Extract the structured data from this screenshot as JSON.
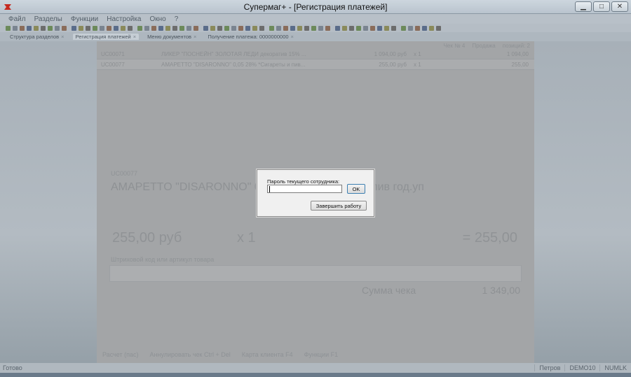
{
  "window": {
    "title": "Супермаг+  - [Регистрация платежей]",
    "minimize": "▁",
    "maximize": "□",
    "close": "✕"
  },
  "menu": [
    "Файл",
    "Разделы",
    "Функции",
    "Настройка",
    "Окно",
    "?"
  ],
  "tabs": [
    {
      "label": "Структура разделов",
      "active": false
    },
    {
      "label": "Регистрация платежей",
      "active": true
    },
    {
      "label": "Меню документов",
      "active": false
    },
    {
      "label": "Получение платежа: 0000000000",
      "active": false
    }
  ],
  "stats": {
    "check_no": "Чек № 4",
    "sales": "Продажа",
    "positions": "позиций: 2"
  },
  "rows": [
    {
      "code": "UC00071",
      "name": "ЛИКЕР \"ПОСНЕЙН\" ЗОЛОТАЯ ЛЕДИ декоратив 15% ...",
      "price": "1 094,00 руб",
      "qty": "x 1",
      "sum": "1 094,00"
    },
    {
      "code": "UC00077",
      "name": "АМАРЕТТО \"DISARONNO\" 0,05 28% *Сигареты и пив...",
      "price": "255,00 руб",
      "qty": "x 1",
      "sum": "255,00"
    }
  ],
  "current_item": {
    "code": "UC00077",
    "name": "AMAPETTO \"DISARONNO\"  0,05 28% *Сигареты и пив год.уп",
    "price": "255,00 руб",
    "qty": "x 1",
    "total": "= 255,00"
  },
  "barcode": {
    "label": "Штриховой код или артикул товара"
  },
  "receipt": {
    "sum_label": "Сумма чека",
    "sum_value": "1 349,00"
  },
  "actions": [
    "Расчет (пас)",
    "Аннулировать чек Ctrl + Del",
    "Карта клиента F4",
    "Функции F1"
  ],
  "status": {
    "left": "Готово",
    "right": [
      "Петров",
      "DEMO10",
      "NUMLK"
    ]
  },
  "dialog": {
    "label": "Пароль текущего сотрудника:",
    "ok": "OK",
    "end_work": "Завершить работу"
  },
  "colors": {
    "accent": "#3c7fb1"
  }
}
